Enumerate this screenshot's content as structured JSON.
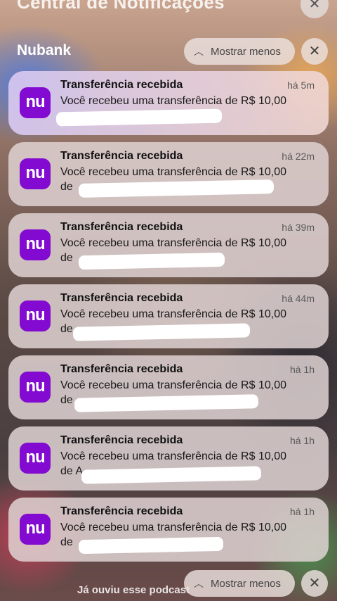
{
  "header": {
    "title": "Central de Notificações"
  },
  "group": {
    "app_name": "Nubank",
    "show_less_label": "Mostrar menos"
  },
  "notifications": [
    {
      "app_icon": "nu",
      "title": "Transferência recebida",
      "time": "há 5m",
      "body": "Você recebeu uma transferência de R$ 10,00",
      "line2": ""
    },
    {
      "app_icon": "nu",
      "title": "Transferência recebida",
      "time": "há 22m",
      "body": "Você recebeu uma transferência de R$ 10,00",
      "line2": "de"
    },
    {
      "app_icon": "nu",
      "title": "Transferência recebida",
      "time": "há 39m",
      "body": "Você recebeu uma transferência de R$ 10,00",
      "line2": "de"
    },
    {
      "app_icon": "nu",
      "title": "Transferência recebida",
      "time": "há 44m",
      "body": "Você recebeu uma transferência de R$ 10,00",
      "line2": "de"
    },
    {
      "app_icon": "nu",
      "title": "Transferência recebida",
      "time": "há 1h",
      "body": "Você recebeu uma transferência de R$ 10,00",
      "line2": "de"
    },
    {
      "app_icon": "nu",
      "title": "Transferência recebida",
      "time": "há 1h",
      "body": "Você recebeu uma transferência de R$ 10,00",
      "line2": "de A"
    },
    {
      "app_icon": "nu",
      "title": "Transferência recebida",
      "time": "há 1h",
      "body": "Você recebeu uma transferência de R$ 10,00",
      "line2": "de"
    }
  ],
  "footer": {
    "text": "Já ouviu esse podcast",
    "show_less_label": "Mostrar menos"
  }
}
